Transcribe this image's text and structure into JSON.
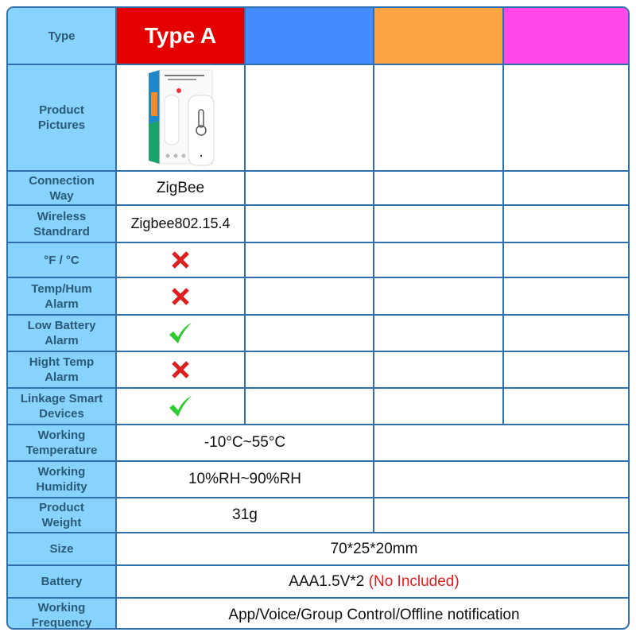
{
  "colors": {
    "label_bg": "#87d3fc",
    "border": "#2f6fad",
    "type_a_header": "#e50000",
    "type_b_header": "#448bff",
    "type_c_header": "#fda445",
    "type_d_header": "#ff48e8",
    "cross": "#e01e1e",
    "check": "#2ecc2e"
  },
  "header": {
    "label": "Type",
    "columns": [
      "Type A",
      "",
      "",
      ""
    ]
  },
  "rows": [
    {
      "label_1": "Product",
      "label_2": "Pictures",
      "value": "product-image"
    },
    {
      "label_1": "Connection",
      "label_2": "Way",
      "value": "ZigBee"
    },
    {
      "label_1": "Wireless",
      "label_2": "Standrard",
      "value": "Zigbee802.15.4"
    },
    {
      "label_1": "°F / °C",
      "label_2": "",
      "value": "cross-icon"
    },
    {
      "label_1": "Temp/Hum",
      "label_2": "Alarm",
      "value": "cross-icon"
    },
    {
      "label_1": "Low Battery",
      "label_2": "Alarm",
      "value": "check-icon"
    },
    {
      "label_1": "Hight Temp",
      "label_2": "Alarm",
      "value": "cross-icon"
    },
    {
      "label_1": "Linkage Smart",
      "label_2": "Devices",
      "value": "check-icon"
    },
    {
      "label_1": "Working",
      "label_2": "Temperature",
      "value": "-10°C~55°C"
    },
    {
      "label_1": "Working",
      "label_2": "Humidity",
      "value": "10%RH~90%RH"
    },
    {
      "label_1": "Product",
      "label_2": "Weight",
      "value": "31g"
    },
    {
      "label_1": "Size",
      "label_2": "",
      "value": "70*25*20mm"
    },
    {
      "label_1": "Battery",
      "label_2": "",
      "value": "AAA1.5V*2",
      "note": "(No Included)"
    },
    {
      "label_1": "Working",
      "label_2": "Frequency",
      "value": "App/Voice/Group Control/Offline notification"
    }
  ]
}
